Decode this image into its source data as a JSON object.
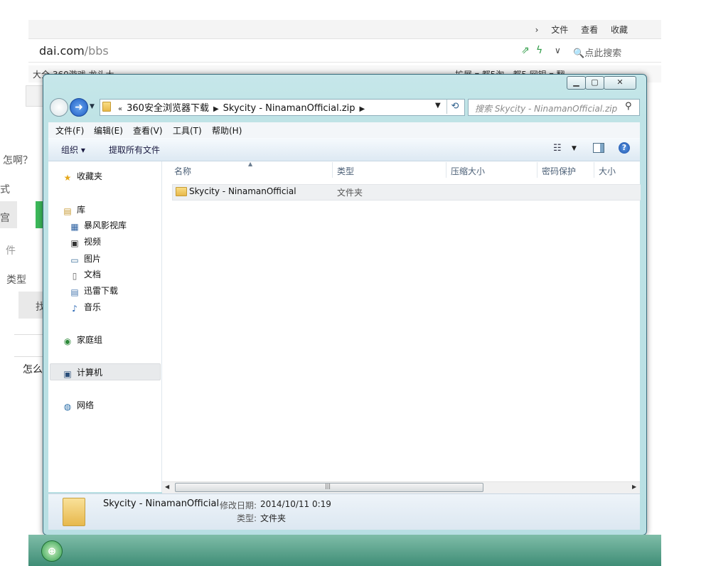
{
  "background_browser": {
    "top_nav": [
      "文件",
      "查看",
      "收藏"
    ],
    "url_main": "dai.com",
    "url_path": "/bbs",
    "search_placeholder": "点此搜索",
    "bookmarks_left": "大全  360游戏  龙头大",
    "bookmarks_right": "扩展 ▾  都5淘一都5  网银 ▾  翻",
    "left_texts": [
      "怎啊？",
      "式",
      "宫",
      "件",
      "类型",
      "找",
      "怎么"
    ]
  },
  "window": {
    "breadcrumb": {
      "overflow": "«",
      "items": [
        "360安全浏览器下载",
        "Skycity - NinamanOfficial.zip"
      ]
    },
    "search_placeholder": "搜索 Skycity - NinamanOfficial.zip",
    "menu": [
      "文件(F)",
      "编辑(E)",
      "查看(V)",
      "工具(T)",
      "帮助(H)"
    ],
    "commands": {
      "organize": "组织 ▾",
      "extract_all": "提取所有文件"
    },
    "nav_pane": {
      "favorites": "收藏夹",
      "library": "库",
      "library_items": [
        "暴风影视库",
        "视频",
        "图片",
        "文档",
        "迅雷下载",
        "音乐"
      ],
      "homegroup": "家庭组",
      "computer": "计算机",
      "network": "网络"
    },
    "columns": [
      "名称",
      "类型",
      "压缩大小",
      "密码保护",
      "大小"
    ],
    "rows": [
      {
        "name": "Skycity - NinamanOfficial",
        "type": "文件夹"
      }
    ],
    "details": {
      "name": "Skycity - NinamanOfficial",
      "modified_label": "修改日期:",
      "modified_value": "2014/10/11 0:19",
      "type_label": "类型:",
      "type_value": "文件夹"
    }
  },
  "colors": {
    "window_frame": "#bfe3e6",
    "taskbar": "#3f8d76",
    "accent_blue": "#1c5bc2"
  }
}
